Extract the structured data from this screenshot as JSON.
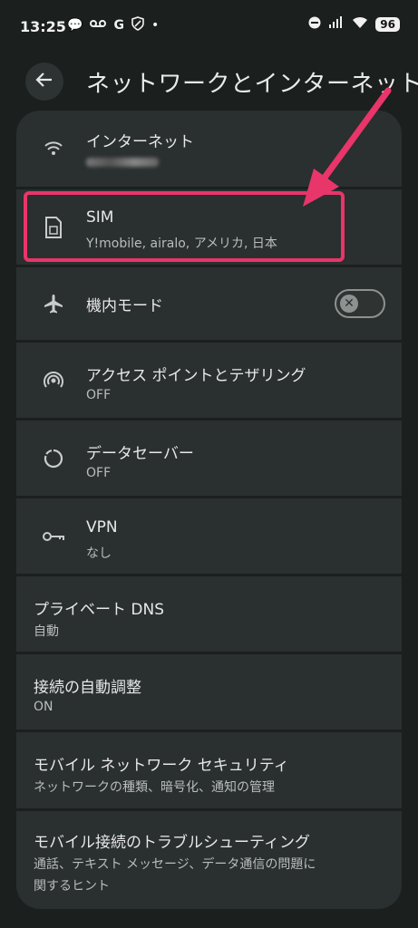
{
  "status_bar": {
    "time": "13:25",
    "left_icons": [
      "chat-bubble-icon",
      "voicemail-icon",
      "google-icon",
      "shield-icon",
      "dot-icon"
    ],
    "right_icons": [
      "do-not-disturb-icon",
      "signal-icon",
      "wifi-icon"
    ],
    "battery": "96"
  },
  "header": {
    "title": "ネットワークとインターネット",
    "back_icon": "arrow-left-icon"
  },
  "settings": [
    {
      "title": "インターネット",
      "subtitle": "",
      "icon": "wifi-icon"
    },
    {
      "title": "SIM",
      "subtitle": "Y!mobile, airalo, アメリカ, 日本",
      "icon": "sim-card-icon"
    },
    {
      "title": "機内モード",
      "subtitle": "",
      "icon": "airplane-icon",
      "toggle": "off"
    },
    {
      "title": "アクセス ポイントとテザリング",
      "subtitle": "OFF",
      "icon": "hotspot-icon"
    },
    {
      "title": "データセーバー",
      "subtitle": "OFF",
      "icon": "data-saver-icon"
    },
    {
      "title": "VPN",
      "subtitle": "なし",
      "icon": "vpn-key-icon"
    },
    {
      "title": "プライベート DNS",
      "subtitle": "自動"
    },
    {
      "title": "接続の自動調整",
      "subtitle": "ON"
    },
    {
      "title": "モバイル ネットワーク セキュリティ",
      "subtitle": "ネットワークの種類、暗号化、通知の管理"
    },
    {
      "title": "モバイル接続のトラブルシューティング",
      "subtitle_line1": "通話、テキスト メッセージ、データ通信の問題に",
      "subtitle_line2": "関するヒント"
    }
  ],
  "colors": {
    "background": "#1b1f1e",
    "card": "#2a2f2f",
    "annotation": "#e8356a"
  }
}
